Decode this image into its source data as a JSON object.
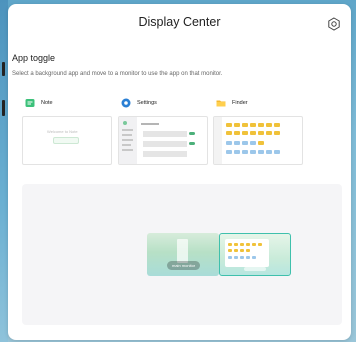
{
  "window": {
    "title": "Display Center"
  },
  "settings_button": {
    "icon": "gear-icon"
  },
  "app_toggle": {
    "title": "App toggle",
    "description": "Select a background app and move to a monitor to use the app on that monitor."
  },
  "apps": [
    {
      "name": "Note",
      "icon": "note-icon",
      "icon_color": "#3cc17a",
      "preview_text": "Welcome to Note"
    },
    {
      "name": "Settings",
      "icon": "settings-app-icon",
      "icon_color": "#2a7fd4"
    },
    {
      "name": "Finder",
      "icon": "folder-icon",
      "icon_color": "#f5b82e"
    }
  ],
  "monitors": [
    {
      "label": "main monitor",
      "selected": false
    },
    {
      "label": "",
      "selected": true,
      "accent": "#3fc0ac"
    }
  ]
}
